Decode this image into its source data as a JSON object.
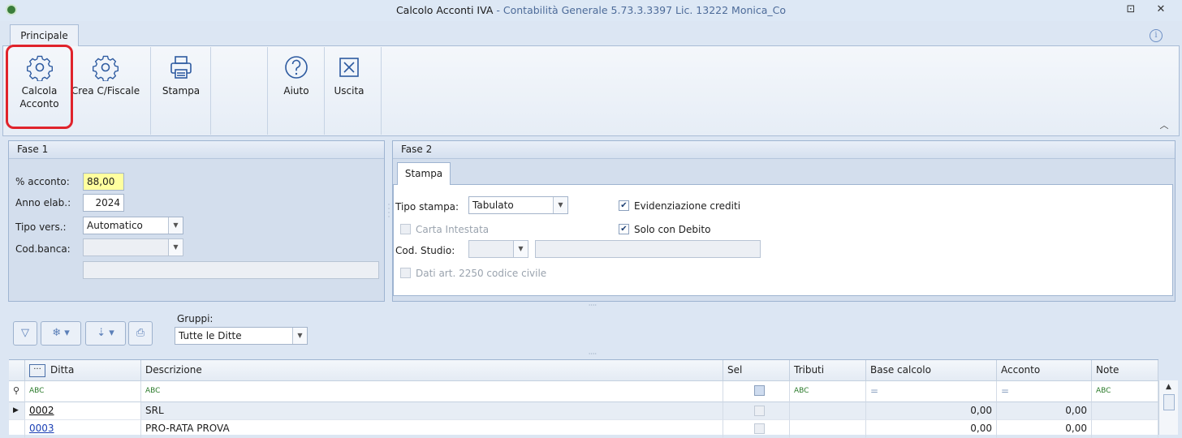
{
  "window": {
    "title_main": "Calcolo Acconti IVA",
    "title_sub": " - Contabilità Generale 5.73.3.3397 Lic. 13222 Monica_Co",
    "restore_glyph": "⊡",
    "close_glyph": "✕"
  },
  "ribbon": {
    "tab": "Principale",
    "info_glyph": "i",
    "collapse_glyph": "︿",
    "buttons": [
      {
        "line1": "Calcola",
        "line2": "Acconto"
      },
      {
        "line1": "Crea C/Fiscale",
        "line2": ""
      },
      {
        "line1": "Stampa",
        "line2": ""
      },
      {
        "line1": "Aiuto",
        "line2": ""
      },
      {
        "line1": "Uscita",
        "line2": ""
      }
    ]
  },
  "fase1": {
    "title": "Fase 1",
    "acconto_label": "% acconto:",
    "acconto_value": "88,00",
    "anno_label": "Anno elab.:",
    "anno_value": "2024",
    "tipo_label": "Tipo vers.:",
    "tipo_value": "Automatico",
    "banca_label": "Cod.banca:",
    "banca_value": "",
    "banca_desc": ""
  },
  "fase2": {
    "title": "Fase 2",
    "tab": "Stampa",
    "tipo_stampa_label": "Tipo stampa:",
    "tipo_stampa_value": "Tabulato",
    "carta_intestata": "Carta Intestata",
    "cod_studio_label": "Cod. Studio:",
    "dati_art": "Dati art. 2250 codice civile",
    "evidenziazione": "Evidenziazione crediti",
    "solo_debito": "Solo con Debito",
    "check_glyph": "✔"
  },
  "toolbar": {
    "gruppi_label": "Gruppi:",
    "gruppi_value": "Tutte le Ditte"
  },
  "grid": {
    "headers": {
      "ditta": "Ditta",
      "descrizione": "Descrizione",
      "sel": "Sel",
      "tributi": "Tributi",
      "base_calcolo": "Base calcolo",
      "acconto": "Acconto",
      "note": "Note"
    },
    "filter_text_glyph": "ABC",
    "filter_eq_glyph": "=",
    "rows": [
      {
        "ditta": "0002",
        "descrizione": "SRL",
        "base_calcolo": "0,00",
        "acconto": "0,00"
      },
      {
        "ditta": "0003",
        "descrizione": "PRO-RATA PROVA",
        "base_calcolo": "0,00",
        "acconto": "0,00"
      }
    ]
  }
}
